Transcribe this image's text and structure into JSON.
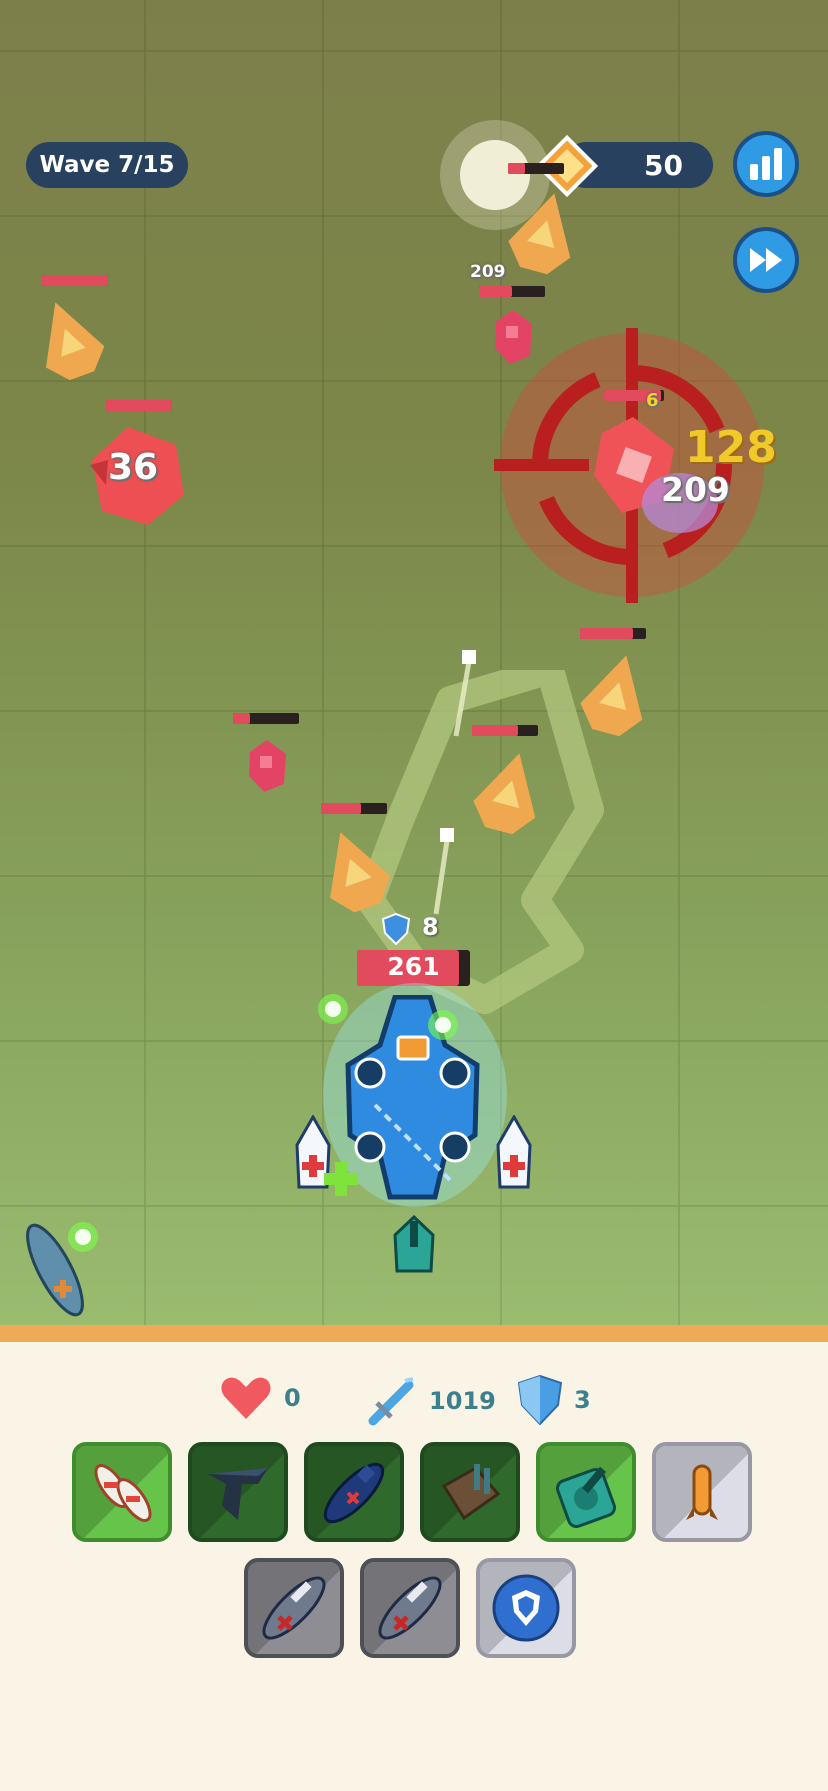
{
  "hud": {
    "wave_label": "Wave 7/15",
    "coins": "50",
    "stats_button_icon": "bar-chart-icon",
    "speed_button_icon": "fast-forward-icon"
  },
  "battlefield": {
    "player": {
      "shield": "8",
      "hp": "261",
      "hp_fraction": 0.9
    },
    "damage_numbers": [
      "36",
      "128",
      "209",
      "209",
      "6"
    ],
    "enemies": [
      {
        "kind": "fighter",
        "hp_fraction": 1.0
      },
      {
        "kind": "heavy",
        "label": "36",
        "hp_fraction": 1.0
      },
      {
        "kind": "fighter",
        "hp_fraction": 0.3
      },
      {
        "kind": "drone",
        "hp_fraction": 0.5
      },
      {
        "kind": "fighter",
        "hp_fraction": 0.8
      },
      {
        "kind": "drone",
        "hp_fraction": 0.25
      },
      {
        "kind": "fighter",
        "hp_fraction": 0.7
      },
      {
        "kind": "fighter",
        "hp_fraction": 0.6
      },
      {
        "kind": "boss",
        "hp_fraction": 0.95
      }
    ]
  },
  "stats": {
    "lives": "0",
    "attack": "1019",
    "defense": "3"
  },
  "cards_row1": [
    {
      "name": "card-twin-planes",
      "icon": "twin-planes-icon",
      "style": "green"
    },
    {
      "name": "card-stealth-bomber",
      "icon": "stealth-bomber-icon",
      "style": "dark"
    },
    {
      "name": "card-submarine",
      "icon": "submarine-icon",
      "style": "dark"
    },
    {
      "name": "card-artillery",
      "icon": "artillery-icon",
      "style": "dark"
    },
    {
      "name": "card-tank-turret",
      "icon": "tank-turret-icon",
      "style": "green"
    },
    {
      "name": "card-missile",
      "icon": "missile-icon",
      "style": "light"
    }
  ],
  "cards_row2": [
    {
      "name": "card-gunboat-locked-1",
      "icon": "gunboat-icon",
      "style": "gray"
    },
    {
      "name": "card-gunboat-locked-2",
      "icon": "gunboat-icon",
      "style": "gray"
    },
    {
      "name": "card-shield",
      "icon": "shield-icon",
      "style": "light"
    }
  ],
  "colors": {
    "accent": "#2e9be4",
    "hp_bar": "#e24a5e",
    "hud_pill": "#27415f",
    "ground_border": "#eeaa55"
  }
}
